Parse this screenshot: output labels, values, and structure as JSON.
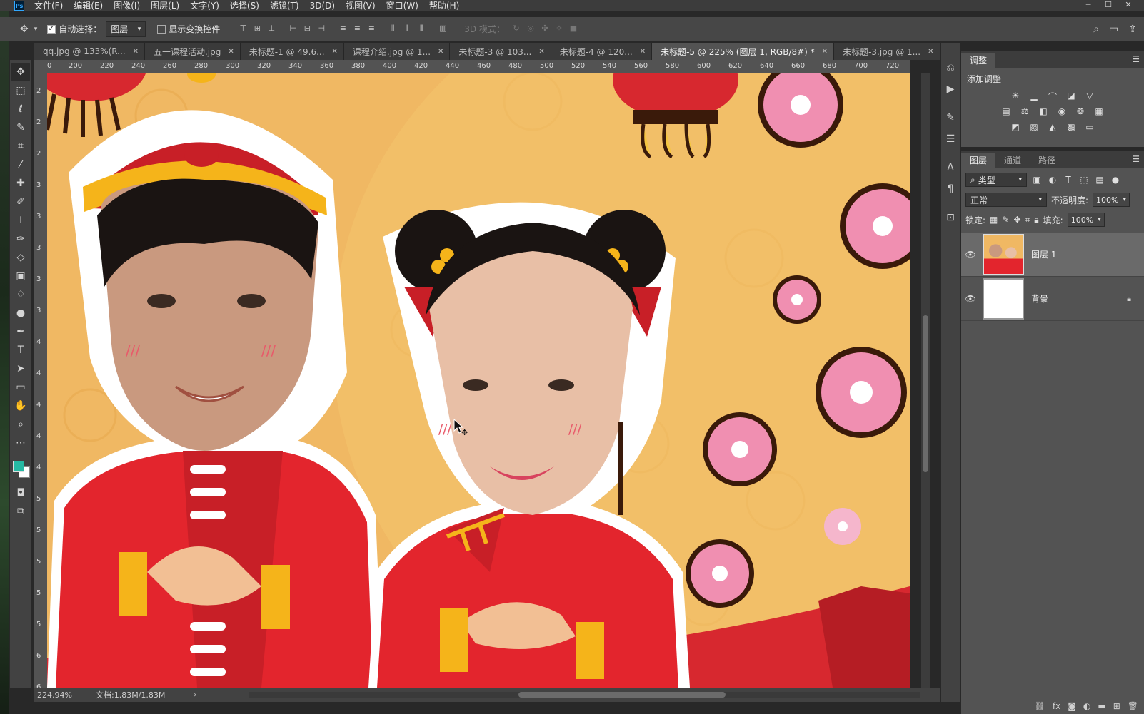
{
  "app": {
    "logo": "Ps"
  },
  "menu": [
    "文件(F)",
    "编辑(E)",
    "图像(I)",
    "图层(L)",
    "文字(Y)",
    "选择(S)",
    "滤镜(T)",
    "3D(D)",
    "视图(V)",
    "窗口(W)",
    "帮助(H)"
  ],
  "options": {
    "auto_select_label": "自动选择：",
    "auto_select_value": "图层",
    "show_transform_label": "显示变换控件",
    "mode_3d_label": "3D 模式："
  },
  "tabs": [
    {
      "label": "qq.jpg @ 133%(R...",
      "active": false
    },
    {
      "label": "五一课程活动.jpg",
      "active": false
    },
    {
      "label": "未标题-1 @ 49.6...",
      "active": false
    },
    {
      "label": "课程介绍.jpg @ 1...",
      "active": false
    },
    {
      "label": "未标题-3 @ 103...",
      "active": false
    },
    {
      "label": "未标题-4 @ 120...",
      "active": false
    },
    {
      "label": "未标题-5 @ 225% (图层 1, RGB/8#) *",
      "active": true
    },
    {
      "label": "未标题-3.jpg @ 1...",
      "active": false
    }
  ],
  "ruler_h": [
    "0",
    "200",
    "220",
    "240",
    "260",
    "280",
    "300",
    "320",
    "340",
    "360",
    "380",
    "400",
    "420",
    "440",
    "460",
    "480",
    "500",
    "520",
    "540",
    "560",
    "580",
    "600",
    "620",
    "640",
    "660",
    "680",
    "700",
    "720"
  ],
  "ruler_v": [
    "2",
    "2",
    "2",
    "3",
    "3",
    "3",
    "3",
    "3",
    "4",
    "4",
    "4",
    "4",
    "4",
    "5",
    "5",
    "5",
    "5",
    "5",
    "6",
    "6"
  ],
  "status": {
    "zoom": "224.94%",
    "doc": "文档:1.83M/1.83M"
  },
  "adjustments": {
    "tab": "调整",
    "add_label": "添加调整"
  },
  "layers_panel": {
    "tabs": [
      "图层",
      "通道",
      "路径"
    ],
    "filter_kind": "类型",
    "blend_mode": "正常",
    "opacity_label": "不透明度:",
    "opacity_value": "100%",
    "lock_label": "锁定:",
    "fill_label": "填充:",
    "fill_value": "100%",
    "layers": [
      {
        "name": "图层 1",
        "selected": true
      },
      {
        "name": "背景",
        "selected": false
      }
    ]
  },
  "colors": {
    "foreground": "#25b9a3",
    "background": "#ffffff",
    "canvas_bg": "#f0b863"
  }
}
